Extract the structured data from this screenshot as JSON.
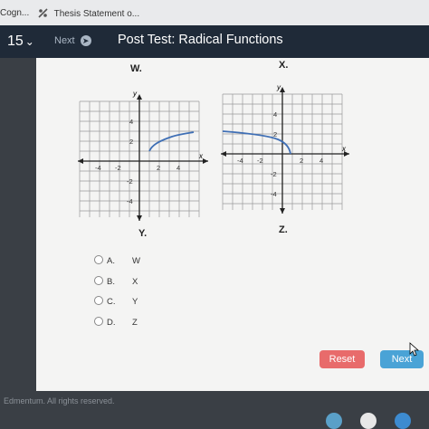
{
  "bookmarks": [
    {
      "label": "Cogn..."
    },
    {
      "label": "Thesis Statement o..."
    }
  ],
  "topbar": {
    "question_number": "15",
    "next_label": "Next",
    "title": "Post Test: Radical Functions"
  },
  "graphs": {
    "w": {
      "label": "W."
    },
    "x": {
      "label": "X."
    },
    "y": {
      "label": "Y."
    },
    "z": {
      "label": "Z."
    },
    "axis_x": "x",
    "axis_y": "y",
    "left_x_ticks": [
      "-4",
      "-2",
      "2",
      "4"
    ],
    "left_y_ticks": [
      "4",
      "2",
      "-2",
      "-4"
    ],
    "right_x_ticks": [
      "-4",
      "-2",
      "2",
      "4"
    ],
    "right_y_ticks": [
      "4",
      "2",
      "-2",
      "-4"
    ],
    "curve_color": "#3f6fb5"
  },
  "choices": [
    {
      "letter": "A.",
      "text": "W"
    },
    {
      "letter": "B.",
      "text": "X"
    },
    {
      "letter": "C.",
      "text": "Y"
    },
    {
      "letter": "D.",
      "text": "Z"
    }
  ],
  "buttons": {
    "reset": "Reset",
    "next": "Next"
  },
  "footer": {
    "copyright": "Edmentum. All rights reserved."
  },
  "colors": {
    "topbar": "#1f2a38",
    "reset": "#e86b6b",
    "next": "#4aa3d6"
  }
}
